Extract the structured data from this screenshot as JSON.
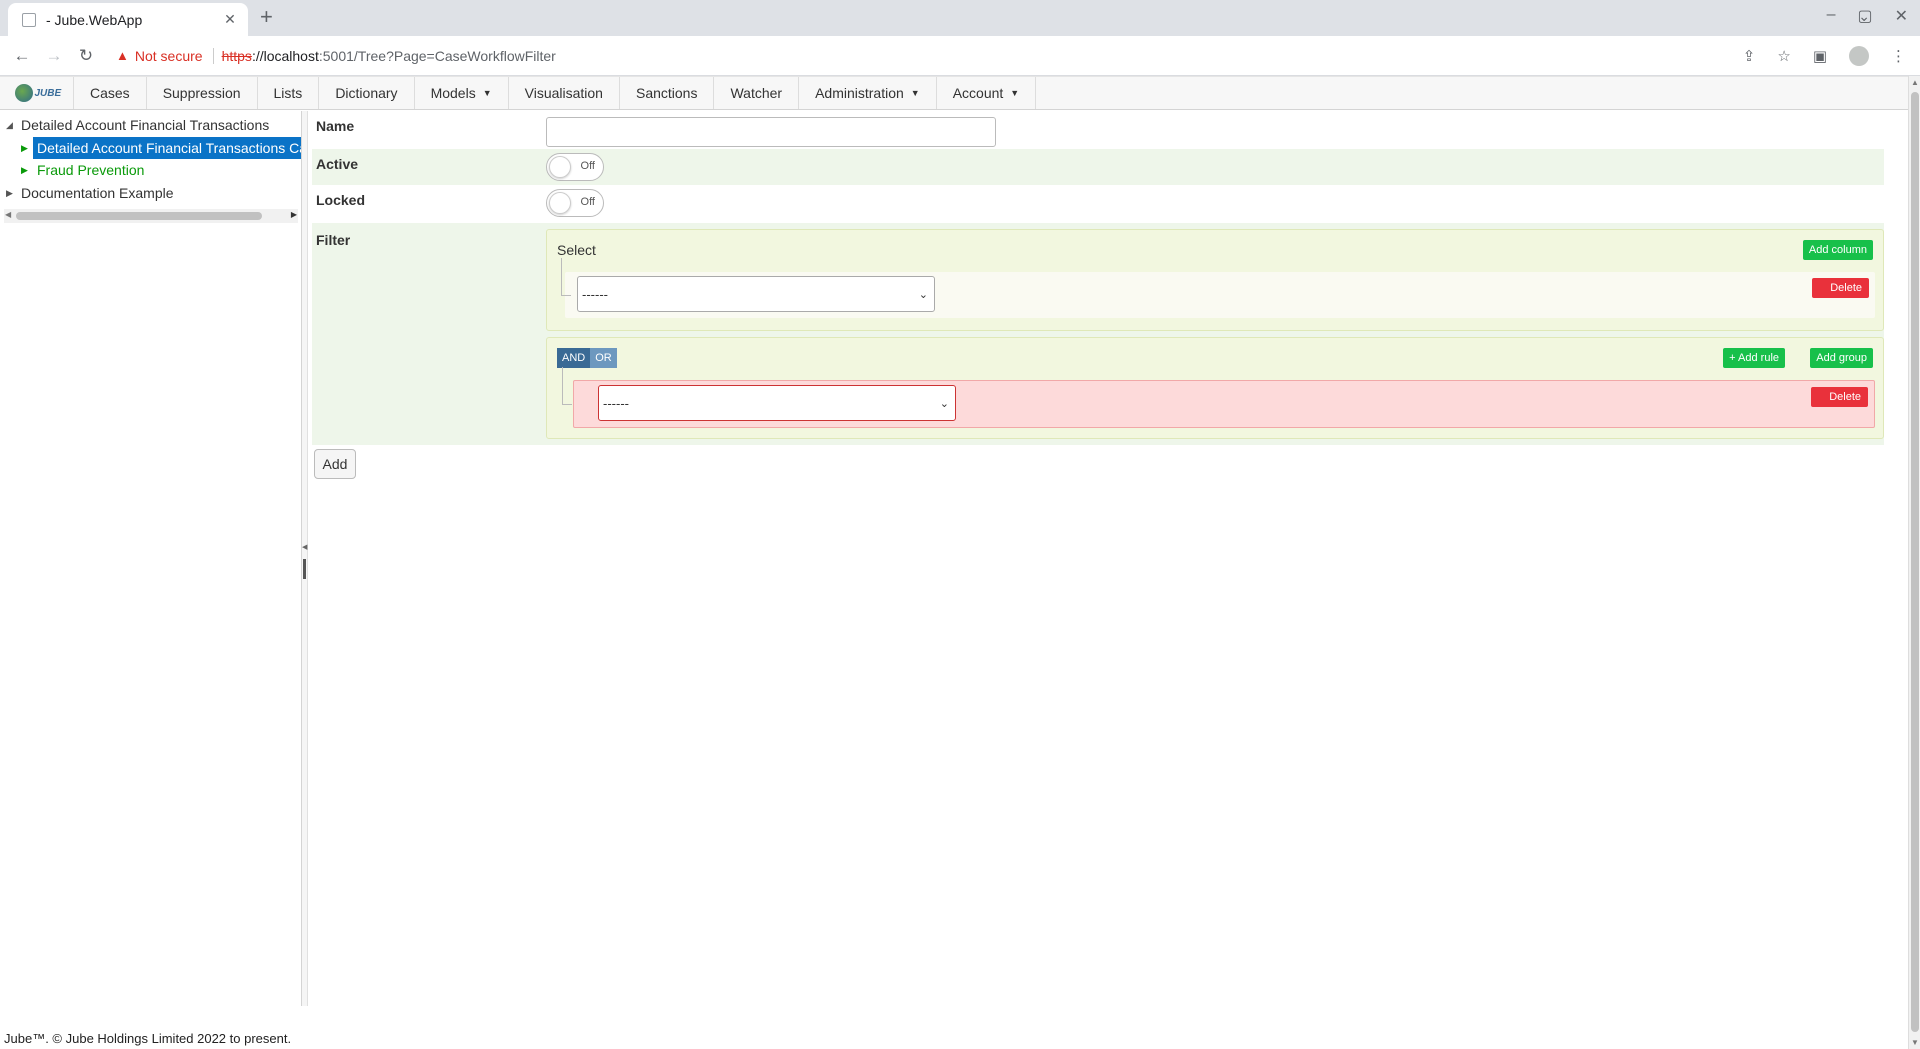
{
  "browser": {
    "tab_title": "- Jube.WebApp",
    "not_secure": "Not secure",
    "url_scheme": "https",
    "url_host": "://localhost",
    "url_path": ":5001/Tree?Page=CaseWorkflowFilter"
  },
  "nav": {
    "logo_text": "JUBE",
    "items": [
      {
        "label": "Cases",
        "dropdown": false
      },
      {
        "label": "Suppression",
        "dropdown": false
      },
      {
        "label": "Lists",
        "dropdown": false
      },
      {
        "label": "Dictionary",
        "dropdown": false
      },
      {
        "label": "Models",
        "dropdown": true
      },
      {
        "label": "Visualisation",
        "dropdown": false
      },
      {
        "label": "Sanctions",
        "dropdown": false
      },
      {
        "label": "Watcher",
        "dropdown": false
      },
      {
        "label": "Administration",
        "dropdown": true
      },
      {
        "label": "Account",
        "dropdown": true
      }
    ]
  },
  "tree": {
    "nodes": [
      {
        "label": "Detailed Account Financial Transactions",
        "expanded": true
      },
      {
        "label": "Detailed Account Financial Transactions Cases",
        "selected": true
      },
      {
        "label": "Fraud Prevention"
      },
      {
        "label": "Documentation Example",
        "expanded": false
      }
    ]
  },
  "form": {
    "name_label": "Name",
    "name_value": "",
    "active_label": "Active",
    "active_state": "Off",
    "locked_label": "Locked",
    "locked_state": "Off",
    "filter_label": "Filter",
    "select_title": "Select",
    "add_column": "Add column",
    "delete": "Delete",
    "select_value": "------",
    "and": "AND",
    "or": "OR",
    "add_rule": "+ Add rule",
    "add_group": "Add group",
    "rule_value": "------",
    "add_button": "Add"
  },
  "footer": "Jube™. © Jube Holdings Limited 2022 to present."
}
